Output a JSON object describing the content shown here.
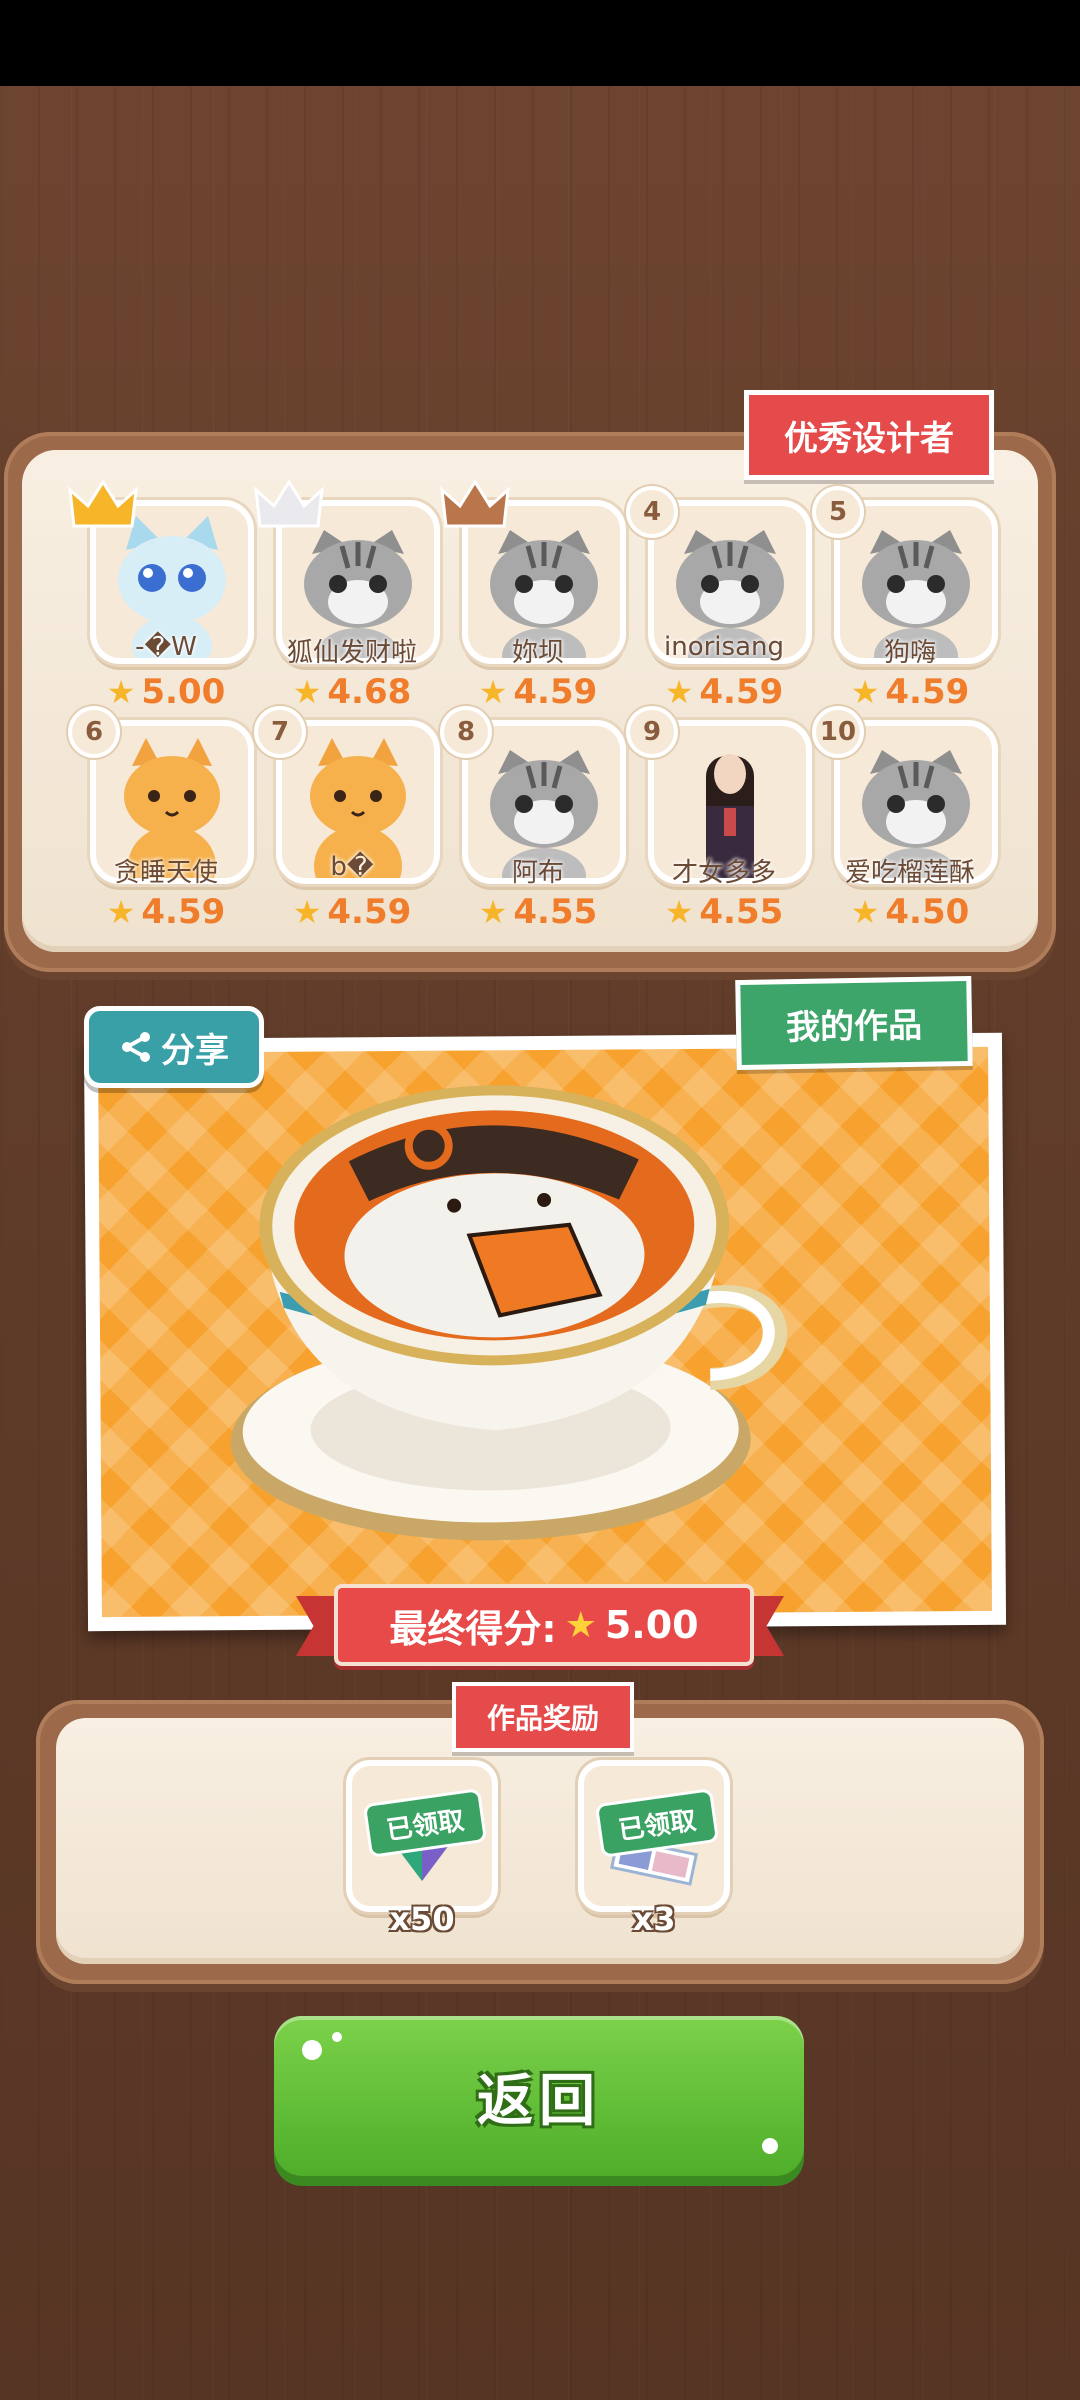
{
  "leaderboard": {
    "title": "优秀设计者",
    "entries": [
      {
        "rank": "1",
        "name": "-�W",
        "score": "5.00",
        "avatar": "blue-cat-avatar",
        "crown": "gold"
      },
      {
        "rank": "2",
        "name": "狐仙发财啦",
        "score": "4.68",
        "avatar": "grey-cat-avatar",
        "crown": "silver"
      },
      {
        "rank": "3",
        "name": "妳坝",
        "score": "4.59",
        "avatar": "grey-cat-avatar",
        "crown": "bronze"
      },
      {
        "rank": "4",
        "name": "inorisang",
        "score": "4.59",
        "avatar": "grey-cat-avatar"
      },
      {
        "rank": "5",
        "name": "狗嗨",
        "score": "4.59",
        "avatar": "grey-cat-avatar"
      },
      {
        "rank": "6",
        "name": "贪睡天使",
        "score": "4.59",
        "avatar": "orange-cat-avatar"
      },
      {
        "rank": "7",
        "name": "b�",
        "score": "4.59",
        "avatar": "orange-cat-avatar"
      },
      {
        "rank": "8",
        "name": "阿布",
        "score": "4.55",
        "avatar": "grey-cat-avatar"
      },
      {
        "rank": "9",
        "name": "才女多多",
        "score": "4.55",
        "avatar": "girl-avatar"
      },
      {
        "rank": "10",
        "name": "爱吃榴莲酥",
        "score": "4.50",
        "avatar": "grey-cat-avatar"
      }
    ]
  },
  "my_work": {
    "title": "我的作品",
    "share_label": "分享",
    "final_score_label": "最终得分:",
    "final_score": "5.00"
  },
  "rewards": {
    "title": "作品奖励",
    "items": [
      {
        "count": "x50",
        "status": "已领取",
        "icon": "gem-icon"
      },
      {
        "count": "x3",
        "status": "已领取",
        "icon": "photo-card-icon"
      }
    ]
  },
  "return_label": "返回",
  "colors": {
    "score_orange": "#ef7d2c",
    "tag_red": "#e54b4b",
    "tag_green": "#3da56a",
    "button_green": "#5fbf33"
  }
}
